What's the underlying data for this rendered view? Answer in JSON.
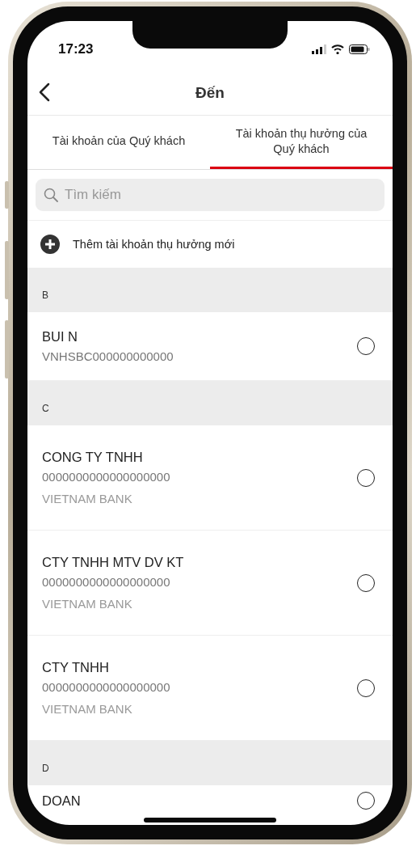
{
  "status_bar": {
    "time": "17:23"
  },
  "header": {
    "title": "Đến"
  },
  "tabs": [
    {
      "label": "Tài khoản của Quý khách",
      "selected": false
    },
    {
      "label": "Tài khoản thụ hưởng của Quý khách",
      "selected": true
    }
  ],
  "search": {
    "placeholder": "Tìm kiếm"
  },
  "add_action": {
    "label": "Thêm tài khoản thụ hưởng mới"
  },
  "sections": [
    {
      "letter": "B",
      "items": [
        {
          "name": "BUI N",
          "account": "VNHSBC000000000000",
          "selected": false
        }
      ]
    },
    {
      "letter": "C",
      "items": [
        {
          "name": "CONG TY TNHH",
          "account": "0000000000000000000",
          "bank": "VIETNAM BANK",
          "selected": false
        },
        {
          "name": "CTY TNHH MTV DV KT",
          "account": "0000000000000000000",
          "bank": "VIETNAM BANK",
          "selected": false
        },
        {
          "name": "CTY TNHH",
          "account": "0000000000000000000",
          "bank": "VIETNAM BANK",
          "selected": false
        }
      ]
    },
    {
      "letter": "D",
      "items": [
        {
          "name": "DOAN",
          "selected": false
        }
      ]
    }
  ]
}
